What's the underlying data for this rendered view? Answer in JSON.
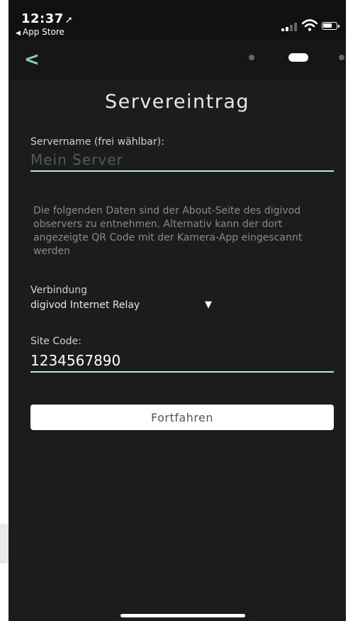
{
  "status_bar": {
    "time": "12:37",
    "location_icon": "location-arrow-icon",
    "back_app_label": "App Store"
  },
  "nav": {
    "back_icon": "chevron-left-icon",
    "page_dots": 3,
    "active_dot": 1
  },
  "page": {
    "title": "Servereintrag",
    "server_name_label": "Servername (frei wählbar):",
    "server_name_placeholder": "Mein Server",
    "server_name_value": "",
    "info_text": "Die folgenden Daten sind der About-Seite des digivod observers zu entnehmen. Alternativ kann der dort angezeigte QR Code mit der Kamera-App eingescannt werden",
    "connection_label": "Verbindung",
    "connection_value": "digivod Internet Relay",
    "site_code_label": "Site Code:",
    "site_code_value": "1234567890",
    "continue_button": "Fortfahren"
  },
  "colors": {
    "accent": "#7fd6be",
    "background": "#1c1c1c",
    "underline": "#b8e6d8"
  }
}
